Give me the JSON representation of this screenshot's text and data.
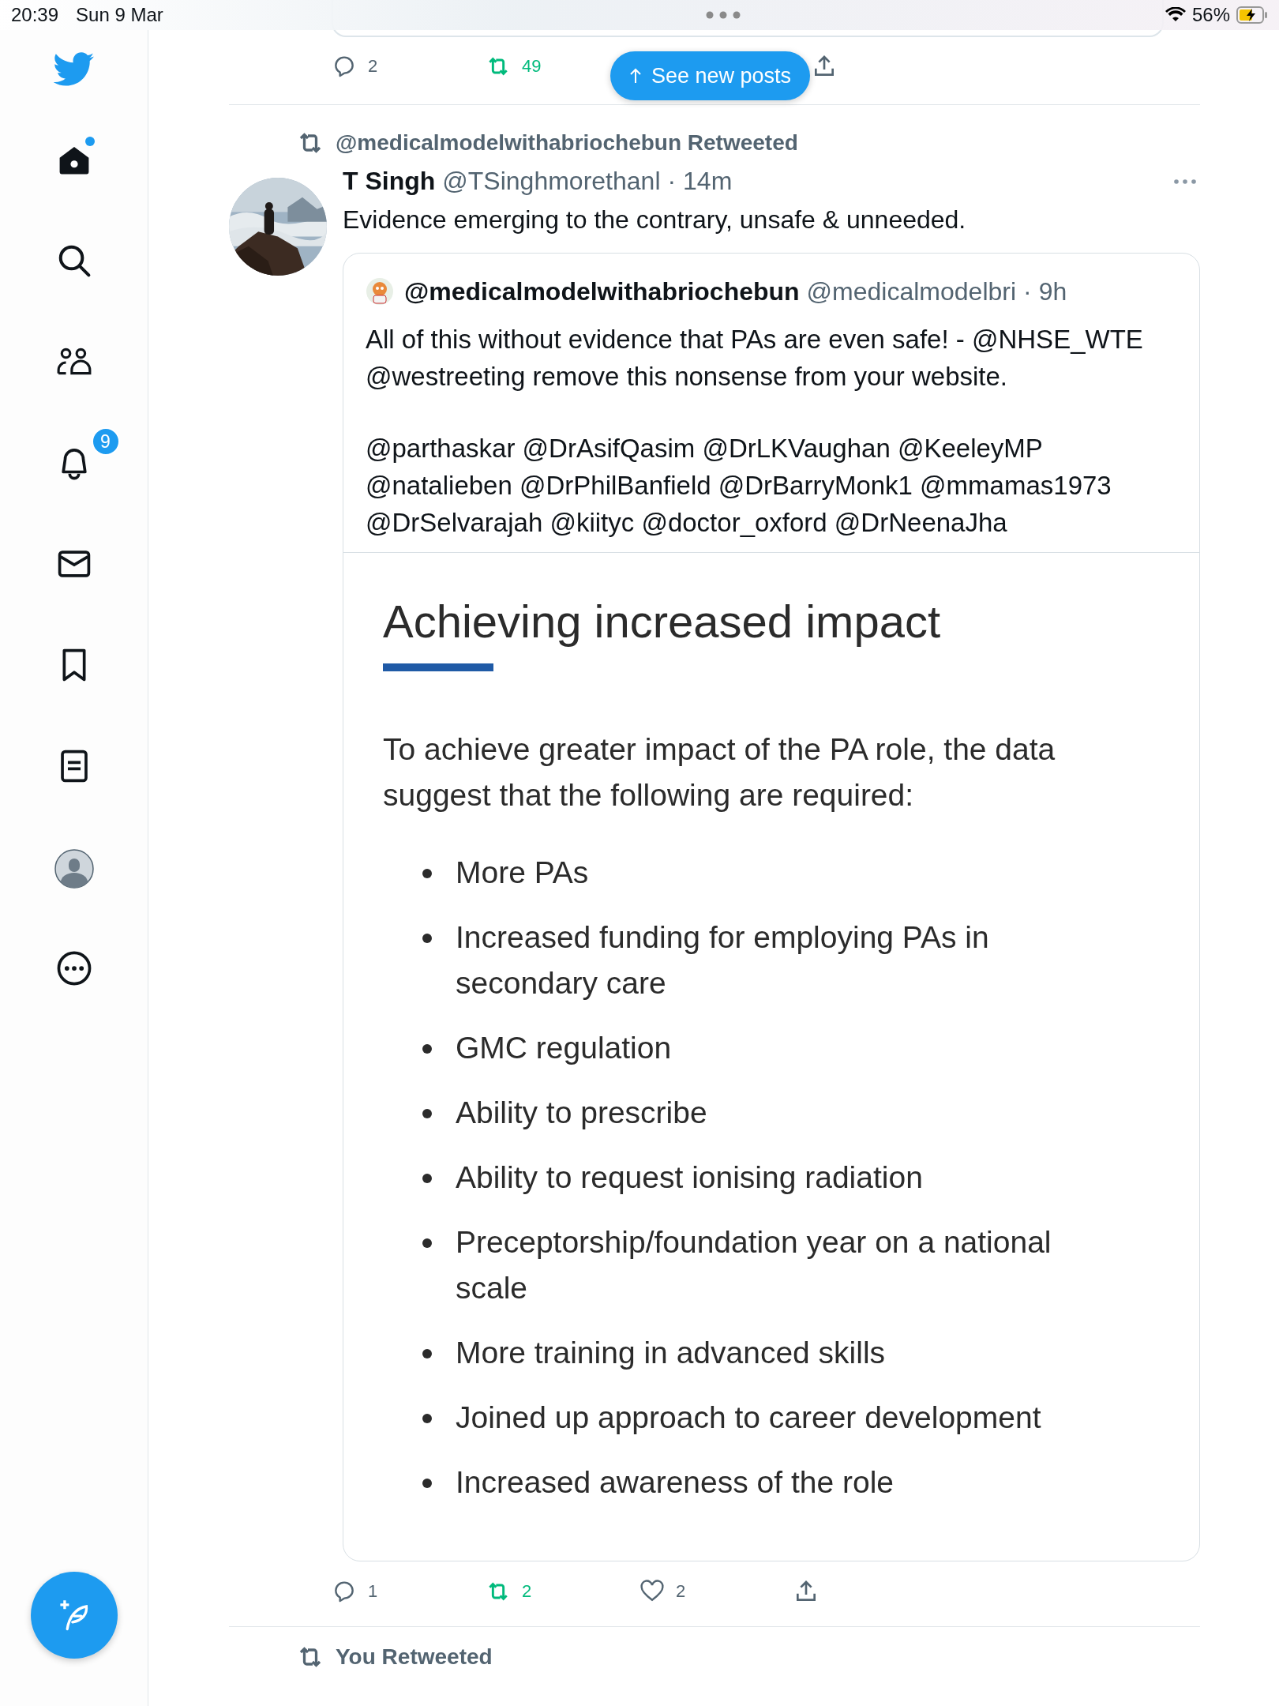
{
  "status_bar": {
    "time": "20:39",
    "date": "Sun 9 Mar",
    "battery": "56%",
    "charging": true
  },
  "sidebar": {
    "items": [
      {
        "kind": "home",
        "dot": true
      },
      {
        "kind": "search"
      },
      {
        "kind": "communities"
      },
      {
        "kind": "notifications",
        "badge": "9"
      },
      {
        "kind": "messages"
      },
      {
        "kind": "bookmarks"
      },
      {
        "kind": "lists"
      },
      {
        "kind": "profile"
      },
      {
        "kind": "more"
      }
    ]
  },
  "previous_tweet": {
    "actions": [
      {
        "kind": "reply",
        "count": "2"
      },
      {
        "kind": "retweet",
        "count": "49",
        "active": true
      },
      {
        "kind": "share"
      }
    ]
  },
  "new_posts_button": "See new posts",
  "tweet": {
    "retweeted_by": "@medicalmodelwithabriochebun Retweeted",
    "name": "T Singh",
    "handle": "@TSinghmorethanl",
    "time": "· 14m",
    "text": "Evidence emerging to the contrary, unsafe & unneeded.",
    "quote": {
      "name": "@medicalmodelwithabriochebun",
      "handle": "@medicalmodelbri",
      "time": "· 9h",
      "paragraphs": [
        "All of this without evidence that PAs are even safe!  - @NHSE_WTE @westreeting remove this nonsense from your website.",
        "@parthaskar @DrAsifQasim @DrLKVaughan @KeeleyMP @natalieben @DrPhilBanfield @DrBarryMonk1 @mmamas1973 @DrSelvarajah @kiityc @doctor_oxford @DrNeenaJha"
      ],
      "image": {
        "title": "Achieving increased impact",
        "intro": "To achieve greater impact of the PA role, the data suggest that the following are required:",
        "bullets": [
          "More PAs",
          "Increased funding for employing PAs in secondary care",
          "GMC regulation",
          "Ability to prescribe",
          "Ability to request ionising radiation",
          "Preceptorship/foundation year on a national scale",
          "More training in advanced skills",
          "Joined up approach to career development",
          "Increased awareness of the role"
        ]
      }
    },
    "actions": [
      {
        "kind": "reply",
        "count": "1"
      },
      {
        "kind": "retweet",
        "count": "2",
        "active": true
      },
      {
        "kind": "like",
        "count": "2",
        "active": false
      },
      {
        "kind": "share"
      }
    ]
  },
  "next_tweet": {
    "retweeted_by": "You Retweeted"
  }
}
